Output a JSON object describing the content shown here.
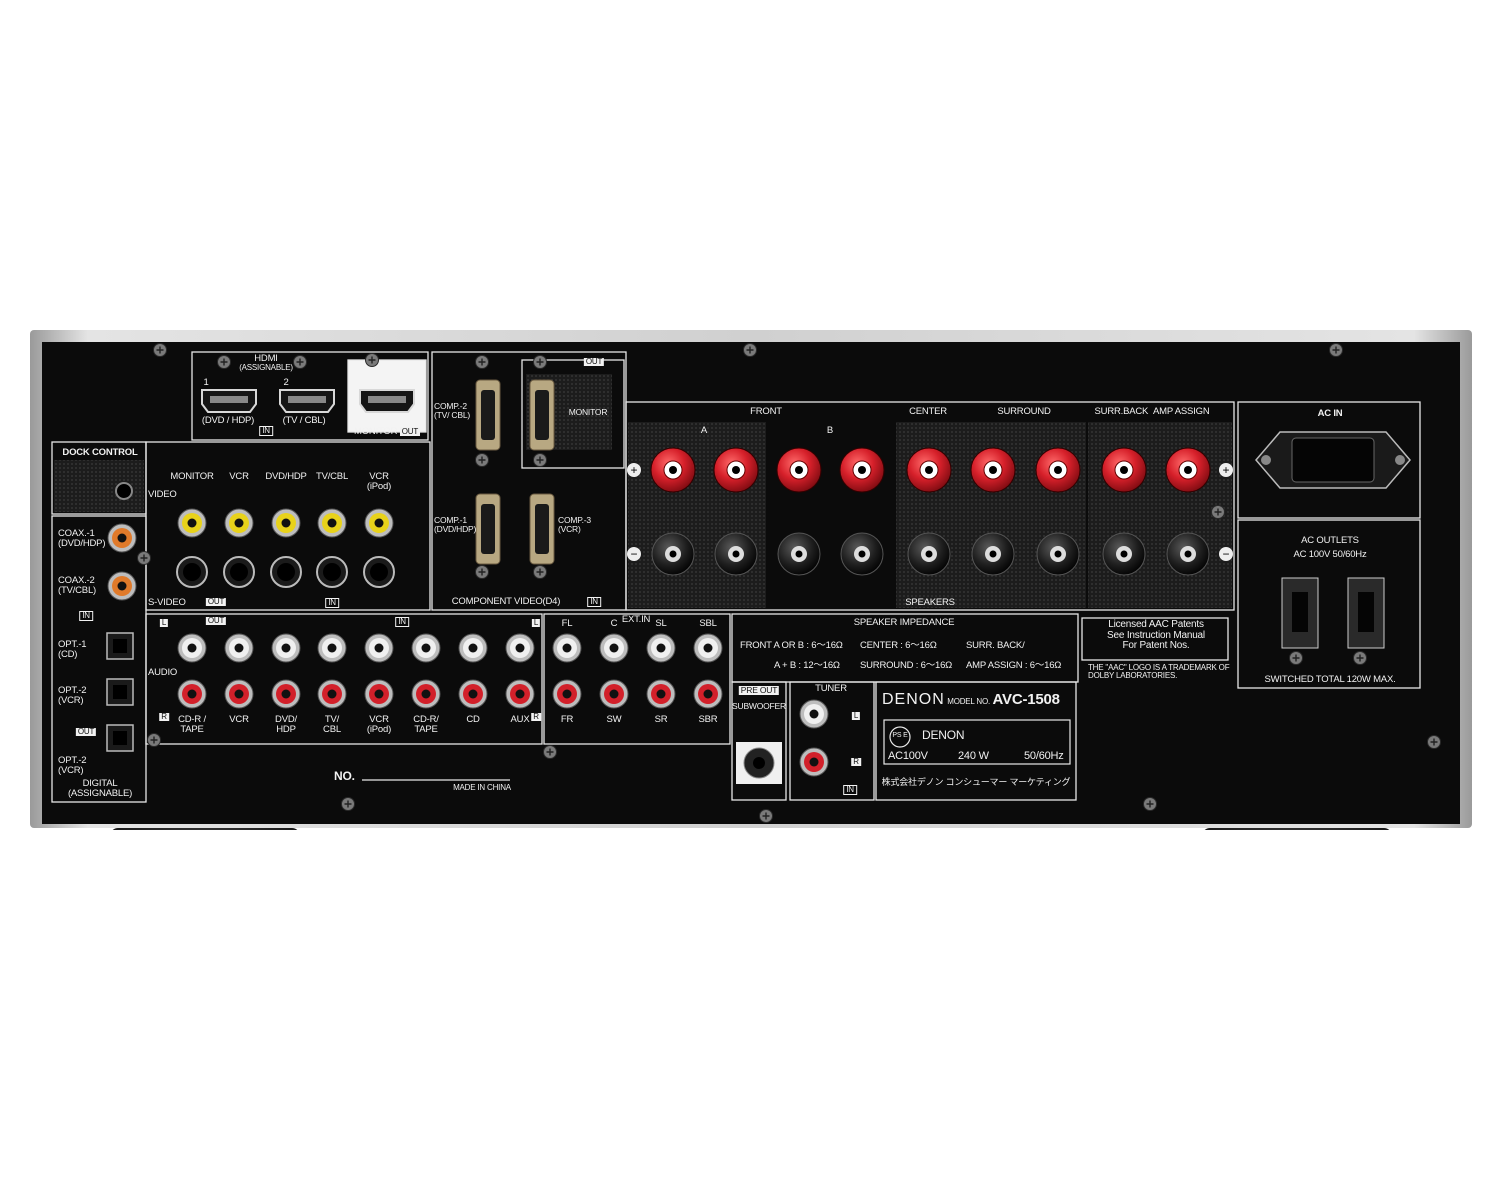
{
  "product": {
    "brand": "DENON",
    "model_prefix": "MODEL NO.",
    "model": "AVC-1508"
  },
  "labels": {
    "hdmi_title": "HDMI",
    "hdmi_assignable": "(ASSIGNABLE)",
    "hdmi_1": "1",
    "hdmi_2": "2",
    "hdmi_1_name": "(DVD / HDP)",
    "hdmi_2_name": "(TV / CBL)",
    "hdmi_in": "IN",
    "monitor_out_label": "MONITOR",
    "monitor_out_tag": "OUT",
    "dock_control": "DOCK CONTROL",
    "video": "VIDEO",
    "video_monitor": "MONITOR",
    "video_vcr": "VCR",
    "video_dvd": "DVD/HDP",
    "video_tv": "TV/CBL",
    "video_vcr_ipod": "VCR",
    "video_ipod": "(iPod)",
    "s_video": "S-VIDEO",
    "sv_out": "OUT",
    "sv_in": "IN",
    "coax1": "COAX.-1",
    "coax1_sub": "(DVD/HDP)",
    "coax2": "COAX.-2",
    "coax2_sub": "(TV/CBL)",
    "digital_in": "IN",
    "opt1": "OPT.-1",
    "opt1_sub": "(CD)",
    "opt2": "OPT.-2",
    "opt2_sub": "(VCR)",
    "opt_out_tag": "OUT",
    "opt3": "OPT.-2",
    "opt3_sub": "(VCR)",
    "digital": "DIGITAL",
    "digital_assignable": "(ASSIGNABLE)",
    "comp2": "COMP.-2",
    "comp2_sub": "(TV/ CBL)",
    "comp_out": "OUT",
    "comp_monitor": "MONITOR",
    "comp1": "COMP.-1",
    "comp1_sub": "(DVD/HDP)",
    "comp3": "COMP.-3",
    "comp3_sub": "(VCR)",
    "component_video": "COMPONENT VIDEO(D4)",
    "comp_in": "IN",
    "front": "FRONT",
    "center": "CENTER",
    "surround": "SURROUND",
    "surr_back": "SURR.BACK",
    "amp_assign": "AMP ASSIGN",
    "r": "R",
    "l": "L",
    "a": "A",
    "b_letter": "B",
    "speakers": "SPEAKERS",
    "ac_in": "AC IN",
    "ac_outlets": "AC OUTLETS",
    "ac_outlets_spec": "AC 100V   50/60Hz",
    "switched": "SWITCHED TOTAL 120W MAX.",
    "audio": "AUDIO",
    "audio_out": "OUT",
    "audio_in": "IN",
    "cdr_tape": "CD-R /",
    "cdr_tape2": "TAPE",
    "a_vcr": "VCR",
    "a_dvd": "DVD/",
    "a_dvd2": "HDP",
    "a_tv": "TV/",
    "a_tv2": "CBL",
    "a_vcr_ipod": "VCR",
    "a_ipod": "(iPod)",
    "a_cdr": "CD-R/",
    "a_cdr2": "TAPE",
    "a_cd": "CD",
    "a_aux": "AUX",
    "ext_in": "EXT.IN",
    "fl": "FL",
    "c": "C",
    "sl": "SL",
    "sbl": "SBL",
    "fr": "FR",
    "sw": "SW",
    "sr": "SR",
    "sbr": "SBR",
    "speaker_impedance": "SPEAKER IMPEDANCE",
    "imp_front": "FRONT  A OR B :  6～16Ω",
    "imp_center": "CENTER        : 6～16Ω",
    "imp_surr_back": "SURR. BACK/",
    "imp_ab": "A  +  B : 12～16Ω",
    "imp_surround": "SURROUND   : 6～16Ω",
    "imp_amp_assign": "AMP ASSIGN  : 6～16Ω",
    "aac_1": "Licensed AAC Patents",
    "aac_2": "See Instruction Manual",
    "aac_3": "For Patent Nos.",
    "aac_tm_1": "THE \"AAC\" LOGO IS A TRADEMARK OF",
    "aac_tm_2": "DOLBY LABORATORIES.",
    "pre_out": "PRE OUT",
    "subwoofer": "SUBWOOFER",
    "tuner": "TUNER",
    "tuner_in": "IN",
    "pse": "PS E",
    "denon_small": "DENON",
    "ac100v": "AC100V",
    "watts": "240 W",
    "hz": "50/60Hz",
    "maker_jp": "株式会社デノン コンシューマー マーケティング",
    "no": "NO.",
    "made_in_china": "MADE IN CHINA"
  },
  "colors": {
    "panel": "#0b0b0b",
    "chrome": "#cfcfcf",
    "red_post": "#d6202a",
    "rca_yellow": "#e8d21a",
    "rca_red": "#d2202a",
    "rca_orange": "#e07a2a"
  }
}
